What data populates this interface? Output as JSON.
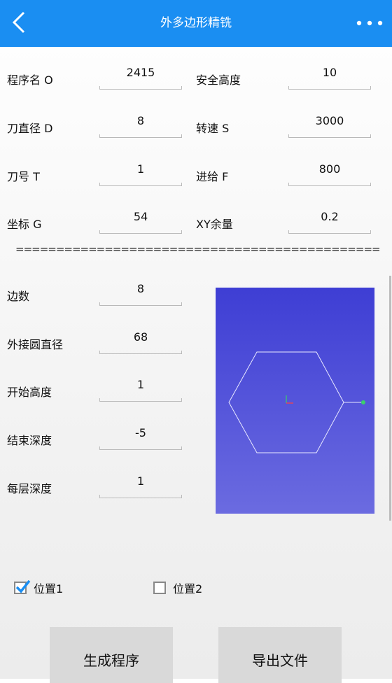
{
  "header": {
    "title": "外多边形精铣"
  },
  "params": [
    {
      "label": "程序名 O",
      "value": "2415"
    },
    {
      "label": "安全高度",
      "value": "10"
    },
    {
      "label": "刀直径 D",
      "value": "8"
    },
    {
      "label": "转速 S",
      "value": "3000"
    },
    {
      "label": "刀号 T",
      "value": "1"
    },
    {
      "label": "进给 F",
      "value": "800"
    },
    {
      "label": "坐标 G",
      "value": "54"
    },
    {
      "label": "XY余量",
      "value": "0.2"
    }
  ],
  "divider": "=================================================",
  "shape": [
    {
      "label": "边数",
      "value": "8"
    },
    {
      "label": "外接圆直径",
      "value": "68"
    },
    {
      "label": "开始高度",
      "value": "1"
    },
    {
      "label": "结束深度",
      "value": "-5"
    },
    {
      "label": "每层深度",
      "value": "1"
    }
  ],
  "positions": [
    {
      "label": "位置1",
      "checked": true
    },
    {
      "label": "位置2",
      "checked": false
    }
  ],
  "buttons": {
    "generate": "生成程序",
    "export": "导出文件"
  },
  "colors": {
    "header": "#1a8ef2",
    "preview_top": "#3e3ed4",
    "preview_bottom": "#6b6be0"
  }
}
